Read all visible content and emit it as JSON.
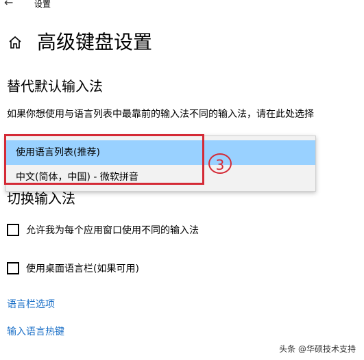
{
  "window": {
    "back_glyph": "←",
    "title": "设置"
  },
  "header": {
    "title": "高级键盘设置"
  },
  "override": {
    "title": "替代默认输入法",
    "description": "如果你想使用与语言列表中最靠前的输入法不同的输入法，请在此处选择",
    "options": [
      "使用语言列表(推荐)",
      "中文(简体，中国) - 微软拼音"
    ],
    "selected": "使用语言列表(推荐)"
  },
  "switching": {
    "title": "切换输入法",
    "checkboxes": [
      {
        "label": "允许我为每个应用窗口使用不同的输入法",
        "checked": false
      },
      {
        "label": "使用桌面语言栏(如果可用)",
        "checked": false
      }
    ]
  },
  "links": {
    "language_bar": "语言栏选项",
    "hotkeys": "输入语言热键"
  },
  "annotation": {
    "step": "3",
    "color": "#d42a36"
  },
  "watermark": "头条 @华硕技术支持",
  "colors": {
    "link": "#1a6fc7",
    "selected_option": "#99d1ff"
  }
}
